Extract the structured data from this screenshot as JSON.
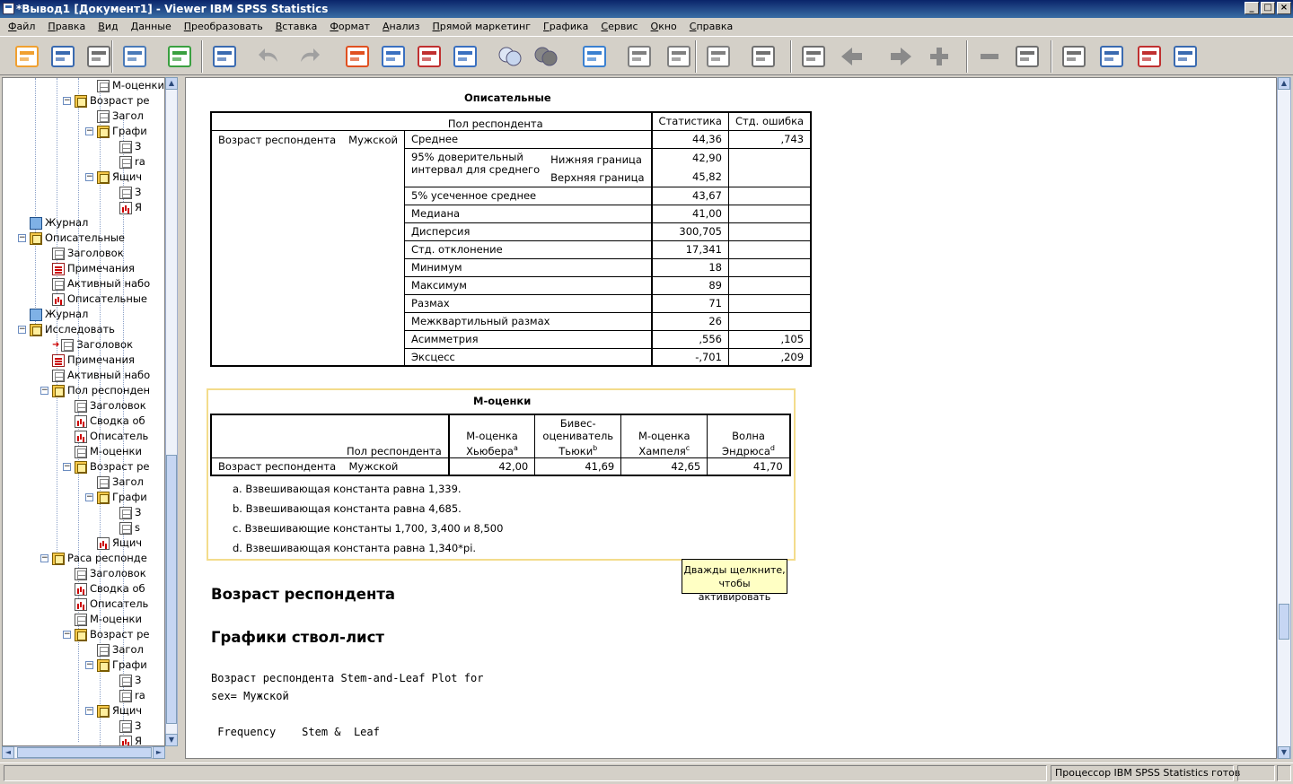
{
  "window": {
    "title": "*Вывод1 [Документ1] - Viewer IBM SPSS Statistics"
  },
  "menu": [
    "Файл",
    "Правка",
    "Вид",
    "Данные",
    "Преобразовать",
    "Вставка",
    "Формат",
    "Анализ",
    "Прямой маркетинг",
    "Графика",
    "Сервис",
    "Окно",
    "Справка"
  ],
  "toolbar": {
    "icons": [
      "open-icon",
      "save-icon",
      "print-icon",
      "print-preview-icon",
      "export-icon",
      "recall-dialog-icon",
      "undo-icon",
      "redo-icon",
      "goto-data-icon",
      "goto-variable-icon",
      "insert-cases-icon",
      "variables-icon",
      "select-cases-icon",
      "weight-cases-icon",
      "split-file-icon",
      "value-labels-icon",
      "designate-window-icon",
      "show-output-icon",
      "insert-heading-icon",
      "designate-icon",
      "back-icon",
      "forward-icon",
      "expand-icon",
      "collapse-icon",
      "show-icon",
      "hide-icon",
      "insert-title-icon",
      "insert-text-icon",
      "insert-text-file-icon"
    ]
  },
  "tree": [
    {
      "label": "М-оценки",
      "level": 4,
      "icon": "tbl"
    },
    {
      "label": "Возраст ре",
      "level": 3,
      "icon": "book",
      "exp": "-"
    },
    {
      "label": "Загол",
      "level": 4,
      "icon": "tbl"
    },
    {
      "label": "Графи",
      "level": 4,
      "icon": "book",
      "exp": "-"
    },
    {
      "label": "З",
      "level": 5,
      "icon": "tbl"
    },
    {
      "label": "ra",
      "level": 5,
      "icon": "tbl"
    },
    {
      "label": "Ящич",
      "level": 4,
      "icon": "book",
      "exp": "-"
    },
    {
      "label": "З",
      "level": 5,
      "icon": "tbl"
    },
    {
      "label": "Я",
      "level": 5,
      "icon": "chart"
    },
    {
      "label": "Журнал",
      "level": 1,
      "icon": "log"
    },
    {
      "label": "Описательные",
      "level": 1,
      "icon": "book",
      "exp": "-"
    },
    {
      "label": "Заголовок",
      "level": 2,
      "icon": "tbl"
    },
    {
      "label": "Примечания",
      "level": 2,
      "icon": "note"
    },
    {
      "label": "Активный набо",
      "level": 2,
      "icon": "tbl"
    },
    {
      "label": "Описательные",
      "level": 2,
      "icon": "chart"
    },
    {
      "label": "Журнал",
      "level": 1,
      "icon": "log"
    },
    {
      "label": "Исследовать",
      "level": 1,
      "icon": "book",
      "exp": "-"
    },
    {
      "label": "Заголовок",
      "level": 2,
      "icon": "tbl",
      "arrow": true
    },
    {
      "label": "Примечания",
      "level": 2,
      "icon": "note"
    },
    {
      "label": "Активный набо",
      "level": 2,
      "icon": "tbl"
    },
    {
      "label": "Пол респонден",
      "level": 2,
      "icon": "book",
      "exp": "-"
    },
    {
      "label": "Заголовок",
      "level": 3,
      "icon": "tbl"
    },
    {
      "label": "Сводка об",
      "level": 3,
      "icon": "chart"
    },
    {
      "label": "Описатель",
      "level": 3,
      "icon": "chart"
    },
    {
      "label": "М-оценки",
      "level": 3,
      "icon": "tbl"
    },
    {
      "label": "Возраст ре",
      "level": 3,
      "icon": "book",
      "exp": "-"
    },
    {
      "label": "Загол",
      "level": 4,
      "icon": "tbl"
    },
    {
      "label": "Графи",
      "level": 4,
      "icon": "book",
      "exp": "-"
    },
    {
      "label": "З",
      "level": 5,
      "icon": "tbl"
    },
    {
      "label": "s",
      "level": 5,
      "icon": "tbl"
    },
    {
      "label": "Ящич",
      "level": 4,
      "icon": "chart"
    },
    {
      "label": "Раса респонде",
      "level": 2,
      "icon": "book",
      "exp": "-"
    },
    {
      "label": "Заголовок",
      "level": 3,
      "icon": "tbl"
    },
    {
      "label": "Сводка об",
      "level": 3,
      "icon": "chart"
    },
    {
      "label": "Описатель",
      "level": 3,
      "icon": "chart"
    },
    {
      "label": "М-оценки",
      "level": 3,
      "icon": "tbl"
    },
    {
      "label": "Возраст ре",
      "level": 3,
      "icon": "book",
      "exp": "-"
    },
    {
      "label": "Загол",
      "level": 4,
      "icon": "tbl"
    },
    {
      "label": "Графи",
      "level": 4,
      "icon": "book",
      "exp": "-"
    },
    {
      "label": "З",
      "level": 5,
      "icon": "tbl"
    },
    {
      "label": "ra",
      "level": 5,
      "icon": "tbl"
    },
    {
      "label": "Ящич",
      "level": 4,
      "icon": "book",
      "exp": "-"
    },
    {
      "label": "З",
      "level": 5,
      "icon": "tbl"
    },
    {
      "label": "Я",
      "level": 5,
      "icon": "chart"
    }
  ],
  "desc": {
    "title": "Описательные",
    "h_group": "Пол респондента",
    "h_stat": "Статистика",
    "h_err": "Стд. ошибка",
    "var": "Возраст респондента",
    "group": "Мужской",
    "ci_label": "95% доверительный интервал для среднего",
    "ci_low": "Нижняя граница",
    "ci_high": "Верхняя граница",
    "rows": [
      {
        "label": "Среднее",
        "stat": "44,36",
        "err": ",743"
      },
      {
        "label": "",
        "stat": "42,90",
        "err": ""
      },
      {
        "label": "",
        "stat": "45,82",
        "err": ""
      },
      {
        "label": "5% усеченное среднее",
        "stat": "43,67",
        "err": ""
      },
      {
        "label": "Медиана",
        "stat": "41,00",
        "err": ""
      },
      {
        "label": "Дисперсия",
        "stat": "300,705",
        "err": ""
      },
      {
        "label": "Стд. отклонение",
        "stat": "17,341",
        "err": ""
      },
      {
        "label": "Минимум",
        "stat": "18",
        "err": ""
      },
      {
        "label": "Максимум",
        "stat": "89",
        "err": ""
      },
      {
        "label": "Размах",
        "stat": "71",
        "err": ""
      },
      {
        "label": "Межквартильный размах",
        "stat": "26",
        "err": ""
      },
      {
        "label": "Асимметрия",
        "stat": ",556",
        "err": ",105"
      },
      {
        "label": "Эксцесс",
        "stat": "-,701",
        "err": ",209"
      }
    ]
  },
  "mest": {
    "title": "М-оценки",
    "h_group": "Пол респондента",
    "h1": "М-оценка Хьюбера",
    "h1s": "a",
    "h2a": "Бивес-",
    "h2b": "оцениватель",
    "h2c": "Тьюки",
    "h2s": "b",
    "h3": "М-оценка Хампеля",
    "h3s": "c",
    "h4": "Волна Эндрюса",
    "h4s": "d",
    "var": "Возраст респондента",
    "group": "Мужской",
    "v1": "42,00",
    "v2": "41,69",
    "v3": "42,65",
    "v4": "41,70",
    "notes": [
      "a. Взвешивающая константа равна 1,339.",
      "b. Взвешивающая константа равна 4,685.",
      "c. Взвешивающие константы 1,700, 3,400 и 8,500",
      "d. Взвешивающая константа равна 1,340*pi."
    ]
  },
  "tooltip": {
    "line1": "Дважды щелкните,",
    "line2": "чтобы активировать"
  },
  "heading1": "Возраст респондента",
  "heading2": "Графики ствол-лист",
  "stem": {
    "line1": "Возраст респондента Stem-and-Leaf Plot for",
    "line2": "sex= Мужской",
    "line3": " Frequency    Stem &  Leaf"
  },
  "status": {
    "processor": "Процессор IBM SPSS Statistics  готов"
  }
}
